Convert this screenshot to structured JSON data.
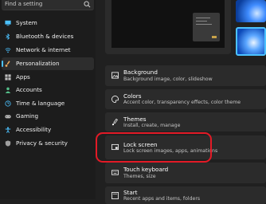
{
  "search": {
    "placeholder": "Find a setting",
    "icon": "search-icon"
  },
  "sidebar": {
    "items": [
      {
        "label": "System",
        "icon": "monitor-icon",
        "color": "#4cc2ff"
      },
      {
        "label": "Bluetooth & devices",
        "icon": "bluetooth-icon",
        "color": "#4cc2ff"
      },
      {
        "label": "Network & internet",
        "icon": "wifi-icon",
        "color": "#4cc2ff"
      },
      {
        "label": "Personalization",
        "icon": "paintbrush-icon",
        "color": "#e8a85c",
        "active": true
      },
      {
        "label": "Apps",
        "icon": "apps-icon",
        "color": "#bdbdbd"
      },
      {
        "label": "Accounts",
        "icon": "person-icon",
        "color": "#55c08a"
      },
      {
        "label": "Time & language",
        "icon": "clock-globe-icon",
        "color": "#4cc2ff"
      },
      {
        "label": "Gaming",
        "icon": "gamepad-icon",
        "color": "#bdbdbd"
      },
      {
        "label": "Accessibility",
        "icon": "accessibility-icon",
        "color": "#4cc2ff"
      },
      {
        "label": "Privacy & security",
        "icon": "shield-icon",
        "color": "#9e9e9e"
      }
    ]
  },
  "main": {
    "rows": [
      {
        "title": "Background",
        "subtitle": "Background image, color, slideshow",
        "icon": "image-icon"
      },
      {
        "title": "Colors",
        "subtitle": "Accent color, transparency effects, color theme",
        "icon": "palette-icon"
      },
      {
        "title": "Themes",
        "subtitle": "Install, create, manage",
        "icon": "brush-icon"
      },
      {
        "title": "Lock screen",
        "subtitle": "Lock screen images, apps, animations",
        "icon": "lock-screen-icon"
      },
      {
        "title": "Touch keyboard",
        "subtitle": "Themes, size",
        "icon": "keyboard-icon"
      },
      {
        "title": "Start",
        "subtitle": "Recent apps and items, folders",
        "icon": "start-icon"
      }
    ]
  },
  "colors": {
    "accent": "#4cc2ff",
    "highlight": "#e31a26"
  }
}
